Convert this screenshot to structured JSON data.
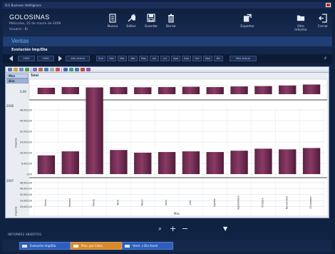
{
  "window": {
    "title": "O.G Business Intelligence"
  },
  "app": {
    "title": "GOLOSINAS",
    "date": "Miércoles, 25 de marzo de 2009",
    "user": "Usuario : BI"
  },
  "toolbar": {
    "nuevo": "Nuevo",
    "editar": "Editar",
    "guardar": "Guardar",
    "borrar": "Borrar",
    "exportar": "Exportar",
    "otro_informe": "Otro Informe",
    "cerrar": "Cerrar"
  },
  "section": {
    "title": "Ventas",
    "subtitle": "Evolución Imp/Dia"
  },
  "filters": {
    "years": [
      "2005",
      "2006"
    ],
    "year_current": "Año Actual",
    "months": [
      "Ene",
      "Feb",
      "Mar",
      "Abr",
      "May",
      "Jun",
      "Jul",
      "Ago",
      "Sep",
      "Oct",
      "Nov",
      "Dic"
    ],
    "month_current": "Mes Actual"
  },
  "olap": {
    "mes_header": "Mes",
    "ano_header": "Año",
    "total_header": "Total",
    "row_2006": "2006",
    "row_2007": "2007",
    "axis_title_y": "Imp/Dia",
    "axis_title_x": "Mes",
    "zero_label": "0,00"
  },
  "chart_data": {
    "type": "bar",
    "categories": [
      "Enero",
      "Febrero",
      "Marzo",
      "Abril",
      "Mayo",
      "Junio",
      "Julio",
      "Agosto",
      "Septiembre",
      "Octubre",
      "Noviembre",
      "Diciembre"
    ],
    "series": [
      {
        "values": [
          14000,
          17000,
          60000,
          18000,
          16000,
          16500,
          17000,
          16500,
          17500,
          19000,
          18500,
          19500
        ]
      }
    ],
    "top_strip_heights_relative": [
      0.45,
      0.55,
      0.5,
      0.55,
      0.52,
      0.55,
      0.6,
      0.55,
      0.65,
      0.7,
      0.8,
      0.95
    ],
    "yticks": [
      "48.000,00",
      "40.000,00",
      "32.000,00",
      "24.000,00",
      "16.000,00",
      "8.000,00",
      "0,00"
    ],
    "yticks_2007": [
      "48.000,00",
      "40.000,00",
      "32.000,00",
      "24.000,00",
      "16.000,00"
    ],
    "ylim": [
      0,
      48000
    ],
    "bar_color": "#8a3a66",
    "grid": true
  },
  "report_tabs": {
    "label": "INFORMES ABIERTOS",
    "tabs": [
      {
        "label": "Evolución Imp/Dia",
        "color": "#2b5fbf"
      },
      {
        "label": "Prov. por Clase",
        "color": "#d98a2b"
      },
      {
        "label": "Vend. x Dia Acum",
        "color": "#2b5fbf"
      }
    ]
  },
  "colors": {
    "header": "#102242",
    "accent": "#6fb4ec",
    "panel": "#e9ecf1"
  }
}
